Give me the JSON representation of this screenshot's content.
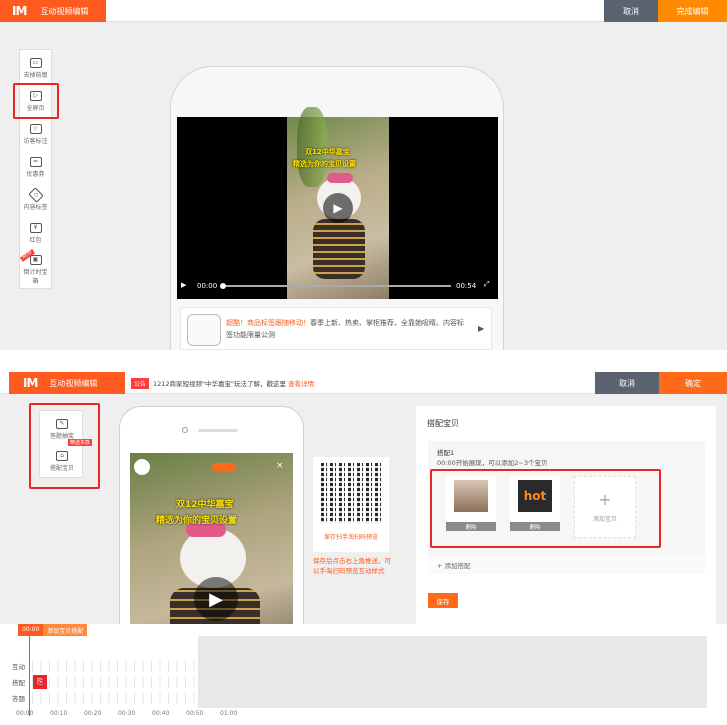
{
  "top": {
    "logo_mark": "IM",
    "app_title": "互动视频编辑",
    "cancel_label": "取消",
    "done_label": "完成编辑",
    "tools": [
      {
        "icon": "camera-icon",
        "label": "去掉前缀"
      },
      {
        "icon": "play-icon",
        "label": "全屏页"
      },
      {
        "icon": "star-icon",
        "label": "访客标注"
      },
      {
        "icon": "coupon-icon",
        "label": "优惠券"
      },
      {
        "icon": "tag-icon",
        "label": "内容标签"
      },
      {
        "icon": "gift-icon",
        "label": "红包"
      },
      {
        "icon": "gift-box-icon",
        "label": "倒计时宝箱",
        "badge": "NEW"
      }
    ],
    "video": {
      "caption_line1": "双12中华嘉宝",
      "caption_line2": "精选为你的宝贝设置",
      "time_current": "00:00",
      "time_total": "00:54"
    },
    "notice": {
      "text_highlight": "超酷！商品标签跟随移动！",
      "text_rest": "春季上新、热卖、掌柜推荐，全靠她吸睛。内容标签功能限量公测"
    }
  },
  "bottom": {
    "logo_mark": "IM",
    "app_title": "互动视频编辑",
    "badge": "公告",
    "announcement": "1212商家短视频\"中华嘉宝\"玩法了解，戳这里",
    "announcement_link": "查看详情",
    "cancel_label": "取消",
    "ok_label": "确定",
    "tools": [
      {
        "icon": "edit-icon",
        "label": "答题抽奖"
      },
      {
        "icon": "bag-icon",
        "label": "搭配宝贝",
        "badge": "精选多款"
      }
    ],
    "phone_banner": "双12中华嘉宝",
    "phone_banner2": "精选为你的宝贝设置",
    "qr_caption": "保存扫手淘扫码预览",
    "hint": "保存后点击右上角推送，可以手淘扫码预览互动样式",
    "panel": {
      "title": "搭配宝贝",
      "pair_name": "搭配1",
      "pair_desc": "00:00开始展现，可以添加2~3个宝贝",
      "items": [
        {
          "delete_label": "删除",
          "img_text": ""
        },
        {
          "delete_label": "删除",
          "img_text": "hot"
        }
      ],
      "add_item_label": "添加宝贝",
      "add_pair_label": "+ 添加搭配",
      "save_label": "保存"
    },
    "timeline": {
      "head_time": "00:00",
      "head_label": "添加宝贝搭配",
      "rows": [
        "互动",
        "搭配",
        "答题"
      ],
      "ticks": [
        "00:00",
        "00:10",
        "00:20",
        "00:30",
        "00:40",
        "00:50",
        "01:00"
      ]
    }
  },
  "colors": {
    "brand": "#ff5a1f",
    "header_dark": "#5b6270",
    "highlight_red": "#e8262a"
  }
}
